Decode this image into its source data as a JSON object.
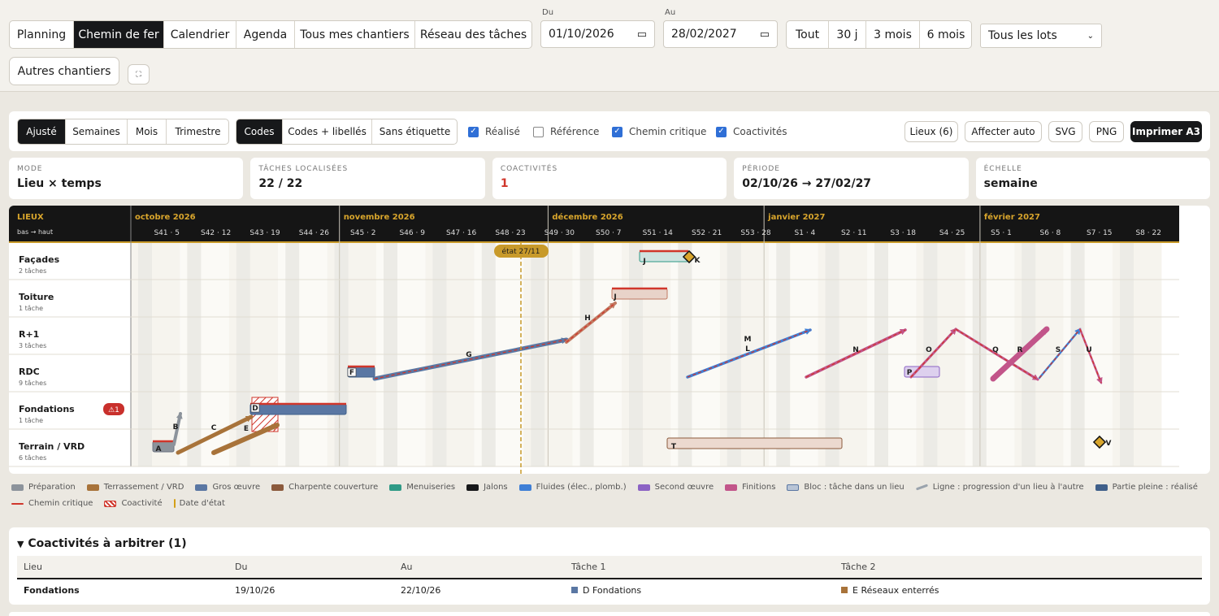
{
  "toolbar": {
    "views": [
      "Planning",
      "Chemin de fer",
      "Calendrier",
      "Agenda",
      "Tous mes chantiers",
      "Réseau des tâches"
    ],
    "active_view": "Chemin de fer",
    "from_label": "Du",
    "from_value": "01/10/2026",
    "to_label": "Au",
    "to_value": "28/02/2027",
    "ranges": [
      "Tout",
      "30 j",
      "3 mois",
      "6 mois"
    ],
    "lot_select": "Tous les lots",
    "other_sites": "Autres chantiers"
  },
  "options": {
    "scale_modes": [
      "Ajusté",
      "Semaines",
      "Mois",
      "Trimestre"
    ],
    "active_scale": "Ajusté",
    "label_modes": [
      "Codes",
      "Codes + libellés",
      "Sans étiquette"
    ],
    "active_label": "Codes",
    "checks": [
      {
        "label": "Réalisé",
        "checked": true
      },
      {
        "label": "Référence",
        "checked": false
      },
      {
        "label": "Chemin critique",
        "checked": true
      },
      {
        "label": "Coactivités",
        "checked": true
      }
    ],
    "actions": [
      "Lieux (6)",
      "Affecter auto",
      "SVG",
      "PNG",
      "Imprimer A3"
    ]
  },
  "kpis": [
    {
      "title": "MODE",
      "value": "Lieu × temps"
    },
    {
      "title": "TÂCHES LOCALISÉES",
      "value": "22 / 22"
    },
    {
      "title": "COACTIVITÉS",
      "value": "1",
      "color": "#d0362b"
    },
    {
      "title": "PÉRIODE",
      "value": "02/10/26 → 27/02/27"
    },
    {
      "title": "ÉCHELLE",
      "value": "semaine"
    }
  ],
  "chart": {
    "header_title": "LIEUX",
    "header_sub": "bas → haut",
    "months": [
      "octobre 2026",
      "novembre 2026",
      "décembre 2026",
      "janvier 2027",
      "février 2027"
    ],
    "weeks": [
      "S41 · 5",
      "S42 · 12",
      "S43 · 19",
      "S44 · 26",
      "S45 · 2",
      "S46 · 9",
      "S47 · 16",
      "S48 · 23",
      "S49 · 30",
      "S50 · 7",
      "S51 · 14",
      "S52 · 21",
      "S53 · 28",
      "S1 · 4",
      "S2 · 11",
      "S3 · 18",
      "S4 · 25",
      "S5 · 1",
      "S6 · 8",
      "S7 · 15",
      "S8 · 22"
    ],
    "status_tag": "état 27/11",
    "rows": [
      {
        "name": "Façades",
        "sub": "2 tâches"
      },
      {
        "name": "Toiture",
        "sub": "1 tâche"
      },
      {
        "name": "R+1",
        "sub": "3 tâches"
      },
      {
        "name": "RDC",
        "sub": "9 tâches"
      },
      {
        "name": "Fondations",
        "sub": "1 tâche",
        "alert": "⚠1"
      },
      {
        "name": "Terrain / VRD",
        "sub": "6 tâches"
      }
    ],
    "task_codes": [
      "A",
      "B",
      "C",
      "D",
      "E",
      "F",
      "G",
      "H",
      "J",
      "K",
      "L",
      "M",
      "N",
      "O",
      "P",
      "Q",
      "R",
      "S",
      "T",
      "U",
      "V"
    ]
  },
  "legend": [
    {
      "label": "Préparation",
      "color": "#8c939b"
    },
    {
      "label": "Terrassement / VRD",
      "color": "#a8733a"
    },
    {
      "label": "Gros œuvre",
      "color": "#5a77a3"
    },
    {
      "label": "Charpente couverture",
      "color": "#8b5a3c"
    },
    {
      "label": "Menuiseries",
      "color": "#2f9a86"
    },
    {
      "label": "Jalons",
      "color": "#17181a"
    },
    {
      "label": "Fluides (élec., plomb.)",
      "color": "#3f7fd6"
    },
    {
      "label": "Second œuvre",
      "color": "#8c63c4"
    },
    {
      "label": "Finitions",
      "color": "#c2558a"
    },
    {
      "label": "Bloc : tâche dans un lieu",
      "color": "#b8c4d6"
    },
    {
      "label": "Ligne : progression d'un lieu à l'autre",
      "color": "#9aa3ad"
    },
    {
      "label": "Partie pleine : réalisé",
      "color": "#3f5f8a"
    },
    {
      "label": "Chemin critique",
      "color": "#d0362b"
    },
    {
      "label": "Coactivité",
      "color": "#d0362b"
    },
    {
      "label": "Date d'état",
      "color": "#d4a017"
    }
  ],
  "coactivities": {
    "title": "Coactivités à arbitrer (1)",
    "columns": [
      "Lieu",
      "Du",
      "Au",
      "Tâche 1",
      "Tâche 2"
    ],
    "rows": [
      {
        "lieu": "Fondations",
        "du": "19/10/26",
        "au": "22/10/26",
        "t1": "D Fondations",
        "t1_color": "#5a77a3",
        "t2": "E Réseaux enterrés",
        "t2_color": "#a8733a"
      }
    ]
  }
}
